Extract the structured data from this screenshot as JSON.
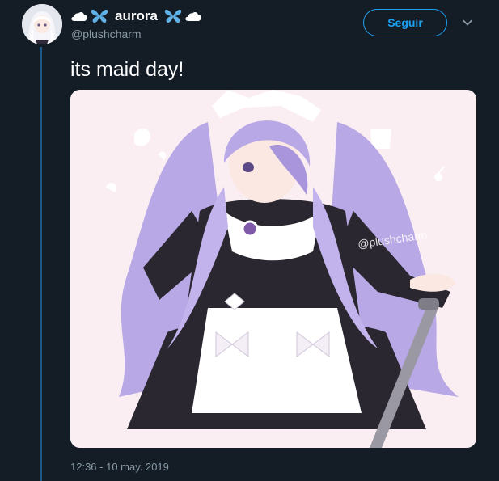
{
  "tweet": {
    "author": {
      "display_name": "aurora",
      "handle": "@plushcharm"
    },
    "follow_label": "Seguir",
    "text": "its maid day!",
    "timestamp": "12:36 - 10 may. 2019",
    "media": {
      "watermark": "@plushcharm"
    }
  },
  "colors": {
    "background": "#141d26",
    "accent": "#1da1f2",
    "muted_text": "#8899a6",
    "thread_line": "#1b5a86"
  },
  "icons": {
    "name_decorations": [
      "cloud-icon",
      "butterfly-icon",
      "butterfly-icon",
      "cloud-icon"
    ],
    "menu": "chevron-down-icon"
  }
}
